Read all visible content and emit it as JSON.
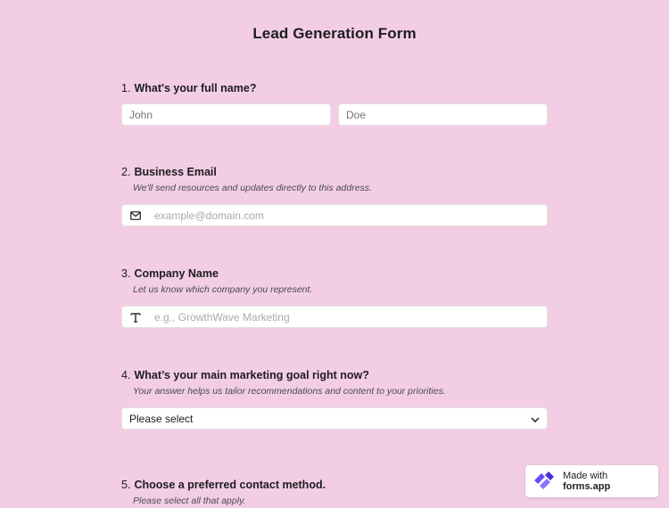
{
  "form": {
    "title": "Lead Generation Form"
  },
  "questions": [
    {
      "number": "1.",
      "label": "What's your full name?",
      "first_placeholder": "John",
      "last_placeholder": "Doe"
    },
    {
      "number": "2.",
      "label": "Business Email",
      "hint": "We'll send resources and updates directly to this address.",
      "placeholder": "example@domain.com",
      "icon": "envelope-icon"
    },
    {
      "number": "3.",
      "label": "Company Name",
      "hint": "Let us know which company you represent.",
      "placeholder": "e.g., GrowthWave Marketing",
      "icon": "text-t-icon"
    },
    {
      "number": "4.",
      "label": "What’s your main marketing goal right now?",
      "hint": "Your answer helps us tailor recommendations and content to your priorities.",
      "selected": "Please select"
    },
    {
      "number": "5.",
      "label": "Choose a preferred contact method.",
      "hint": "Please select all that apply."
    }
  ],
  "badge": {
    "prefix": "Made with",
    "brand": "forms.app",
    "icon": "formsapp-logo-icon",
    "logo_color": "#6b4cf5"
  }
}
